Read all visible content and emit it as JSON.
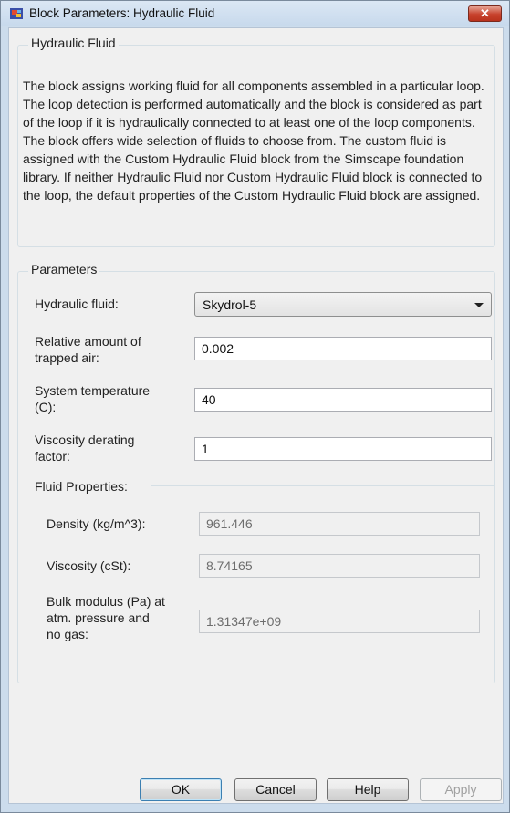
{
  "window": {
    "title": "Block Parameters: Hydraulic Fluid",
    "close_glyph": "✕"
  },
  "description_group": {
    "label": "Hydraulic Fluid",
    "text": "The block assigns working fluid for all components assembled in a particular loop. The loop detection is performed automatically and the block is considered as part of the loop if it is hydraulically connected to at least one of the loop components. The block offers wide selection of fluids to choose from. The custom fluid is assigned with the Custom Hydraulic Fluid block from the Simscape foundation library. If neither Hydraulic Fluid nor Custom Hydraulic Fluid block is connected to the loop, the default properties of the Custom Hydraulic Fluid block are assigned."
  },
  "parameters": {
    "label": "Parameters",
    "hydraulic_fluid": {
      "label": "Hydraulic fluid:",
      "value": "Skydrol-5"
    },
    "trapped_air": {
      "label_line1": "Relative amount of",
      "label_line2": "trapped air:",
      "value": "0.002"
    },
    "temperature": {
      "label_line1": "System temperature",
      "label_line2": "(C):",
      "value": "40"
    },
    "viscosity_derating": {
      "label_line1": "Viscosity derating",
      "label_line2": "factor:",
      "value": "1"
    }
  },
  "fluid_properties": {
    "label": "Fluid Properties:",
    "density": {
      "label": "Density (kg/m^3):",
      "value": "961.446"
    },
    "viscosity": {
      "label": "Viscosity (cSt):",
      "value": "8.74165"
    },
    "bulk_modulus": {
      "label_line1": "Bulk modulus (Pa) at",
      "label_line2": "atm. pressure and",
      "label_line3": "no gas:",
      "value": "1.31347e+09"
    }
  },
  "buttons": {
    "ok": "OK",
    "cancel": "Cancel",
    "help": "Help",
    "apply": "Apply"
  },
  "colors": {
    "title_bar": "#c7d9ec",
    "close_button": "#c7422c",
    "dialog_bg": "#f0f0f0",
    "default_button_border": "#3c7fb1"
  },
  "icons": {
    "app": "simulink-block-icon",
    "close": "close-icon",
    "dropdown": "chevron-down-icon"
  }
}
